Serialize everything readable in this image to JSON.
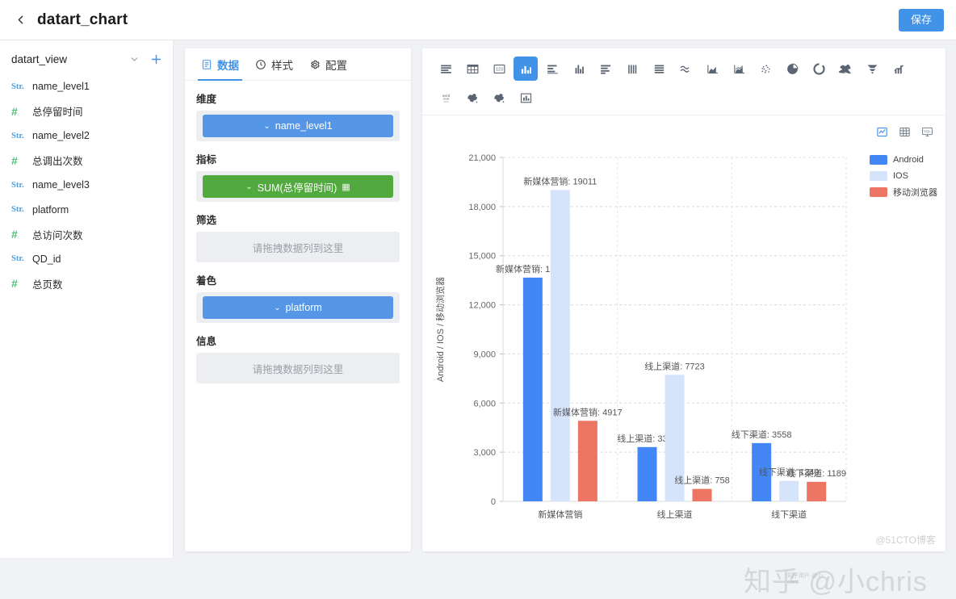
{
  "topbar": {
    "back_icon": "chevron-left-icon",
    "title": "datart_chart",
    "save_label": "保存"
  },
  "sidebar": {
    "view_name": "datart_view",
    "caret_icon": "chevron-down-icon",
    "plus_icon": "plus-icon",
    "fields": [
      {
        "type": "Str.",
        "kind": "string",
        "name": "name_level1"
      },
      {
        "type": "#",
        "kind": "number",
        "name": "总停留时间"
      },
      {
        "type": "Str.",
        "kind": "string",
        "name": "name_level2"
      },
      {
        "type": "#",
        "kind": "number",
        "name": "总调出次数"
      },
      {
        "type": "Str.",
        "kind": "string",
        "name": "name_level3"
      },
      {
        "type": "Str.",
        "kind": "string",
        "name": "platform"
      },
      {
        "type": "#",
        "kind": "number",
        "name": "总访问次数"
      },
      {
        "type": "Str.",
        "kind": "string",
        "name": "QD_id"
      },
      {
        "type": "#",
        "kind": "number",
        "name": "总页数"
      }
    ]
  },
  "config": {
    "tabs": [
      {
        "label": "数据",
        "icon": "list-icon",
        "active": true
      },
      {
        "label": "样式",
        "icon": "palette-icon",
        "active": false
      },
      {
        "label": "配置",
        "icon": "gear-icon",
        "active": false
      }
    ],
    "sections": [
      {
        "label": "维度",
        "chip": {
          "text": "name_level1",
          "color": "blue"
        }
      },
      {
        "label": "指标",
        "chip": {
          "text": "SUM(总停留时间)",
          "color": "green",
          "agg": "▦"
        }
      },
      {
        "label": "筛选",
        "placeholder": "请拖拽数据列到这里"
      },
      {
        "label": "着色",
        "chip": {
          "text": "platform",
          "color": "blue"
        }
      },
      {
        "label": "信息",
        "placeholder": "请拖拽数据列到这里"
      }
    ]
  },
  "chart_types": {
    "row1": [
      "table-icon",
      "grid-table-icon",
      "number-card-icon",
      "bar-chart-icon",
      "horizontal-bar-icon",
      "column-chart-icon",
      "bar-ranking-icon",
      "vertical-lines-icon",
      "stacked-rows-icon",
      "wave-line-icon",
      "area-chart-icon",
      "line-area-icon",
      "scatter-icon",
      "pie-chart-icon",
      "doughnut-icon",
      "treemap-icon",
      "funnel-icon",
      "bar-line-combo-icon"
    ],
    "row2": [
      "word-cloud-icon",
      "china-map-icon",
      "china-map-outline-icon",
      "bar-chart-box-icon"
    ],
    "selected_index": 3
  },
  "chart_view_toggles": [
    {
      "icon": "chart-view-icon",
      "active": true
    },
    {
      "icon": "table-view-icon",
      "active": false
    },
    {
      "icon": "sql-view-icon",
      "active": false
    }
  ],
  "watermark": {
    "main": "知乎 @小chris",
    "sub": "@51CTO博客",
    "stamp": "知乎用户 @小chris"
  },
  "chart_data": {
    "type": "bar",
    "title": "",
    "xlabel": "",
    "ylabel": "Android / IOS / 移动浏览器",
    "ylim": [
      0,
      21000
    ],
    "yticks": [
      0,
      3000,
      6000,
      9000,
      12000,
      15000,
      18000,
      21000
    ],
    "ytick_labels": [
      "0",
      "3,000",
      "6,000",
      "9,000",
      "12,000",
      "15,000",
      "18,000",
      "21,000"
    ],
    "grid": true,
    "legend_position": "right-top",
    "categories": [
      "新媒体营销",
      "线上渠道",
      "线下渠道"
    ],
    "series": [
      {
        "name": "Android",
        "color": "#4287f5",
        "values": [
          13661,
          3313,
          3558
        ]
      },
      {
        "name": "IOS",
        "color": "#d6e4fb",
        "values": [
          19011,
          7723,
          1249
        ]
      },
      {
        "name": "移动浏览器",
        "color": "#ed7563",
        "values": [
          4917,
          758,
          1189
        ]
      }
    ],
    "data_labels": [
      {
        "series": "Android",
        "category": "新媒体营销",
        "text": "新媒体营销: 13661"
      },
      {
        "series": "IOS",
        "category": "新媒体营销",
        "text": "新媒体营销: 19011"
      },
      {
        "series": "移动浏览器",
        "category": "新媒体营销",
        "text": "新媒体营销: 4917"
      },
      {
        "series": "Android",
        "category": "线上渠道",
        "text": "线上渠道: 3313"
      },
      {
        "series": "IOS",
        "category": "线上渠道",
        "text": "线上渠道: 7723"
      },
      {
        "series": "移动浏览器",
        "category": "线上渠道",
        "text": "线上渠道: 758"
      },
      {
        "series": "Android",
        "category": "线下渠道",
        "text": "线下渠道: 3558"
      },
      {
        "series": "IOS",
        "category": "线下渠道",
        "text": "线下渠道: 1249"
      },
      {
        "series": "移动浏览器",
        "category": "线下渠道",
        "text": "线下渠道: 1189"
      }
    ]
  }
}
